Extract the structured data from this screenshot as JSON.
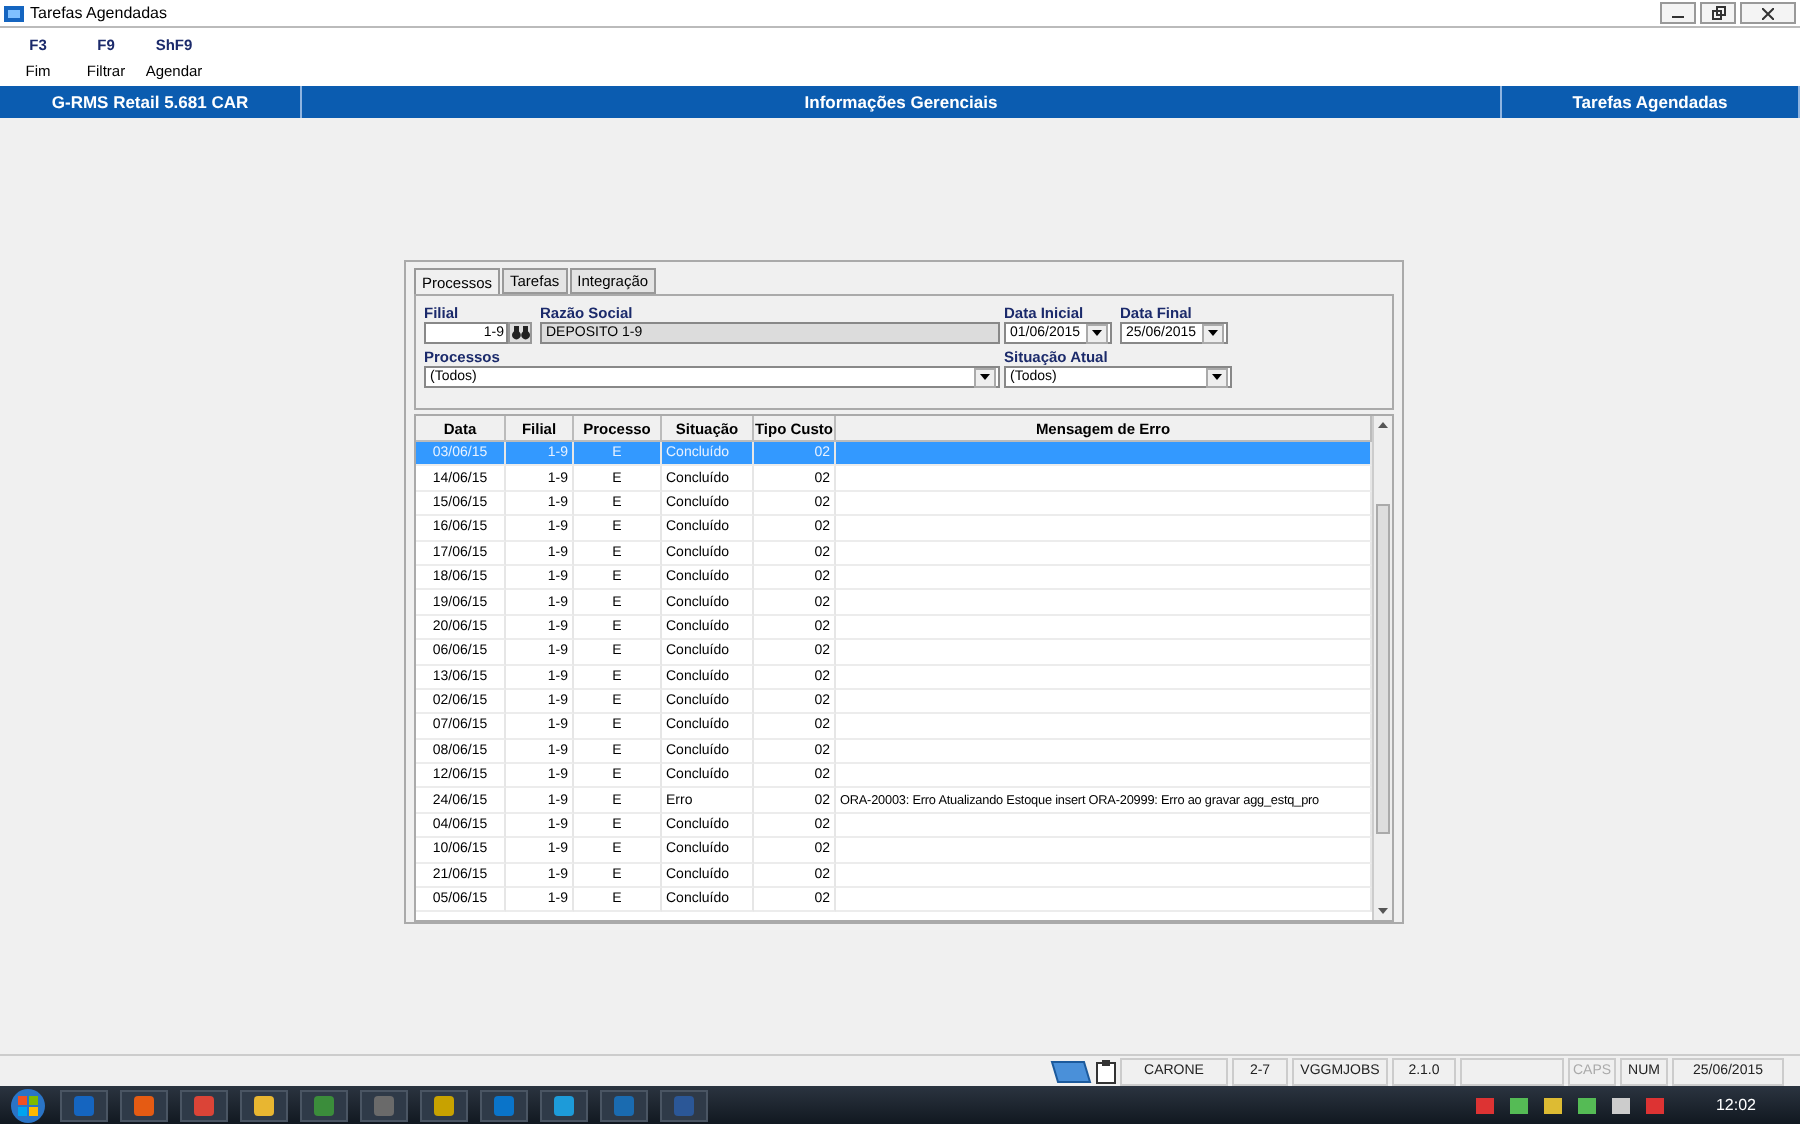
{
  "window": {
    "title": "Tarefas Agendadas"
  },
  "toolbar": [
    {
      "key": "F3",
      "label": "Fim"
    },
    {
      "key": "F9",
      "label": "Filtrar"
    },
    {
      "key": "ShF9",
      "label": "Agendar"
    }
  ],
  "header": {
    "app": "G-RMS Retail 5.681 CAR",
    "section": "Informações Gerenciais",
    "screen": "Tarefas Agendadas"
  },
  "tabs": [
    {
      "label": "Processos",
      "selected": true
    },
    {
      "label": "Tarefas",
      "selected": false
    },
    {
      "label": "Integração",
      "selected": false
    }
  ],
  "filters": {
    "filial_label": "Filial",
    "filial": "1-9",
    "razao_label": "Razão Social",
    "razao": "DEPOSITO 1-9",
    "data_inicial_label": "Data Inicial",
    "data_inicial": "01/06/2015",
    "data_final_label": "Data Final",
    "data_final": "25/06/2015",
    "processos_label": "Processos",
    "processos": "(Todos)",
    "situacao_label": "Situação Atual",
    "situacao": "(Todos)"
  },
  "table": {
    "columns": [
      "Data",
      "Filial",
      "Processo",
      "Situação",
      "Tipo Custo",
      "Mensagem de Erro"
    ],
    "rows": [
      {
        "cells": [
          "03/06/15",
          "1-9",
          "E",
          "Concluído",
          "02",
          ""
        ],
        "selected": true
      },
      {
        "cells": [
          "14/06/15",
          "1-9",
          "E",
          "Concluído",
          "02",
          ""
        ],
        "selected": false
      },
      {
        "cells": [
          "15/06/15",
          "1-9",
          "E",
          "Concluído",
          "02",
          ""
        ],
        "selected": false
      },
      {
        "cells": [
          "16/06/15",
          "1-9",
          "E",
          "Concluído",
          "02",
          ""
        ],
        "selected": false
      },
      {
        "cells": [
          "17/06/15",
          "1-9",
          "E",
          "Concluído",
          "02",
          ""
        ],
        "selected": false
      },
      {
        "cells": [
          "18/06/15",
          "1-9",
          "E",
          "Concluído",
          "02",
          ""
        ],
        "selected": false
      },
      {
        "cells": [
          "19/06/15",
          "1-9",
          "E",
          "Concluído",
          "02",
          ""
        ],
        "selected": false
      },
      {
        "cells": [
          "20/06/15",
          "1-9",
          "E",
          "Concluído",
          "02",
          ""
        ],
        "selected": false
      },
      {
        "cells": [
          "06/06/15",
          "1-9",
          "E",
          "Concluído",
          "02",
          ""
        ],
        "selected": false
      },
      {
        "cells": [
          "13/06/15",
          "1-9",
          "E",
          "Concluído",
          "02",
          ""
        ],
        "selected": false
      },
      {
        "cells": [
          "02/06/15",
          "1-9",
          "E",
          "Concluído",
          "02",
          ""
        ],
        "selected": false
      },
      {
        "cells": [
          "07/06/15",
          "1-9",
          "E",
          "Concluído",
          "02",
          ""
        ],
        "selected": false
      },
      {
        "cells": [
          "08/06/15",
          "1-9",
          "E",
          "Concluído",
          "02",
          ""
        ],
        "selected": false
      },
      {
        "cells": [
          "12/06/15",
          "1-9",
          "E",
          "Concluído",
          "02",
          ""
        ],
        "selected": false
      },
      {
        "cells": [
          "24/06/15",
          "1-9",
          "E",
          "Erro",
          "02",
          "ORA-20003: Erro Atualizando Estoque insert ORA-20999: Erro ao gravar agg_estq_pro"
        ],
        "selected": false
      },
      {
        "cells": [
          "04/06/15",
          "1-9",
          "E",
          "Concluído",
          "02",
          ""
        ],
        "selected": false
      },
      {
        "cells": [
          "10/06/15",
          "1-9",
          "E",
          "Concluído",
          "02",
          ""
        ],
        "selected": false
      },
      {
        "cells": [
          "21/06/15",
          "1-9",
          "E",
          "Concluído",
          "02",
          ""
        ],
        "selected": false
      },
      {
        "cells": [
          "05/06/15",
          "1-9",
          "E",
          "Concluído",
          "02",
          ""
        ],
        "selected": false
      }
    ]
  },
  "status_bar": {
    "fields": [
      "CARONE",
      "2-7",
      "VGGMJOBS",
      "2.1.0"
    ],
    "indicators": [
      {
        "label": "CAPS",
        "on": false
      },
      {
        "label": "NUM",
        "on": true
      }
    ],
    "date": "25/06/2015"
  },
  "taskbar": {
    "clock": "12:02"
  }
}
